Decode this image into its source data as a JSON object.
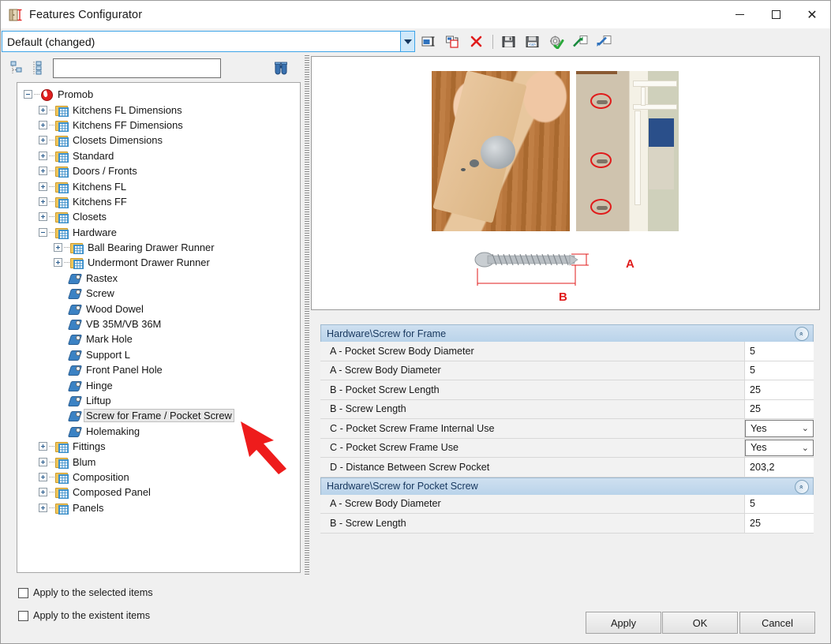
{
  "window": {
    "title": "Features Configurator",
    "icon": "cabinet-dimension-icon",
    "controls": {
      "minimize": "–",
      "maximize": "□",
      "close": "✕"
    }
  },
  "profile_combo": {
    "value": "Default (changed)",
    "arrow": "chevron-down-icon"
  },
  "toolbar": {
    "buttons": [
      {
        "name": "rename-configuration",
        "icon": "rename-icon"
      },
      {
        "name": "copy-configuration",
        "icon": "copy-icon"
      },
      {
        "name": "delete-configuration",
        "icon": "delete-x-icon"
      },
      {
        "name": "save-configuration",
        "icon": "floppy-save-icon"
      },
      {
        "name": "save-as-xml",
        "icon": "save-xml-icon"
      },
      {
        "name": "apply-settings",
        "icon": "gear-check-icon"
      },
      {
        "name": "export-configuration",
        "icon": "green-arrow-export-icon"
      },
      {
        "name": "import-configuration",
        "icon": "blue-arrow-import-icon"
      }
    ]
  },
  "tree_toolbar": {
    "collapse_all_icon": "collapse-tree-icon",
    "expand_all_icon": "expand-tree-icon",
    "search_value": "",
    "search_placeholder": "",
    "find_icon": "binoculars-icon"
  },
  "tree": {
    "root": "Promob",
    "items": [
      {
        "label": "Promob",
        "depth": 0,
        "state": "expanded",
        "icon": "promob-root-icon",
        "selected": false
      },
      {
        "label": "Kitchens FL Dimensions",
        "depth": 1,
        "state": "collapsed",
        "icon": "folder-icon",
        "selected": false
      },
      {
        "label": "Kitchens FF Dimensions",
        "depth": 1,
        "state": "collapsed",
        "icon": "folder-icon",
        "selected": false
      },
      {
        "label": "Closets Dimensions",
        "depth": 1,
        "state": "collapsed",
        "icon": "folder-icon",
        "selected": false
      },
      {
        "label": "Standard",
        "depth": 1,
        "state": "collapsed",
        "icon": "folder-icon",
        "selected": false
      },
      {
        "label": "Doors / Fronts",
        "depth": 1,
        "state": "collapsed",
        "icon": "folder-icon",
        "selected": false
      },
      {
        "label": "Kitchens FL",
        "depth": 1,
        "state": "collapsed",
        "icon": "folder-icon",
        "selected": false
      },
      {
        "label": "Kitchens FF",
        "depth": 1,
        "state": "collapsed",
        "icon": "folder-icon",
        "selected": false
      },
      {
        "label": "Closets",
        "depth": 1,
        "state": "collapsed",
        "icon": "folder-icon",
        "selected": false
      },
      {
        "label": "Hardware",
        "depth": 1,
        "state": "expanded",
        "icon": "folder-icon",
        "selected": false
      },
      {
        "label": "Ball Bearing Drawer Runner",
        "depth": 2,
        "state": "collapsed",
        "icon": "folder-icon",
        "selected": false
      },
      {
        "label": "Undermont Drawer Runner",
        "depth": 2,
        "state": "collapsed",
        "icon": "folder-icon",
        "selected": false
      },
      {
        "label": "Rastex",
        "depth": 2,
        "state": "leaf",
        "icon": "tag-icon",
        "selected": false
      },
      {
        "label": "Screw",
        "depth": 2,
        "state": "leaf",
        "icon": "tag-icon",
        "selected": false
      },
      {
        "label": "Wood Dowel",
        "depth": 2,
        "state": "leaf",
        "icon": "tag-icon",
        "selected": false
      },
      {
        "label": "VB 35M/VB 36M",
        "depth": 2,
        "state": "leaf",
        "icon": "tag-icon",
        "selected": false
      },
      {
        "label": "Mark Hole",
        "depth": 2,
        "state": "leaf",
        "icon": "tag-icon",
        "selected": false
      },
      {
        "label": "Support L",
        "depth": 2,
        "state": "leaf",
        "icon": "tag-icon",
        "selected": false
      },
      {
        "label": "Front Panel Hole",
        "depth": 2,
        "state": "leaf",
        "icon": "tag-icon",
        "selected": false
      },
      {
        "label": "Hinge",
        "depth": 2,
        "state": "leaf",
        "icon": "tag-icon",
        "selected": false
      },
      {
        "label": "Liftup",
        "depth": 2,
        "state": "leaf",
        "icon": "tag-icon",
        "selected": false
      },
      {
        "label": "Screw for Frame / Pocket Screw",
        "depth": 2,
        "state": "leaf",
        "icon": "tag-icon",
        "selected": true
      },
      {
        "label": "Holemaking",
        "depth": 2,
        "state": "leaf",
        "icon": "tag-icon",
        "selected": false
      },
      {
        "label": "Fittings",
        "depth": 1,
        "state": "collapsed",
        "icon": "folder-icon",
        "selected": false
      },
      {
        "label": "Blum",
        "depth": 1,
        "state": "collapsed",
        "icon": "folder-icon",
        "selected": false
      },
      {
        "label": "Composition",
        "depth": 1,
        "state": "collapsed",
        "icon": "folder-icon",
        "selected": false
      },
      {
        "label": "Composed Panel",
        "depth": 1,
        "state": "collapsed",
        "icon": "folder-icon",
        "selected": false
      },
      {
        "label": "Panels",
        "depth": 1,
        "state": "collapsed",
        "icon": "folder-icon",
        "selected": false
      }
    ]
  },
  "checkboxes": [
    {
      "label": "Apply to the selected items",
      "checked": false
    },
    {
      "label": "Apply to the existent items",
      "checked": false
    }
  ],
  "preview": {
    "description": "Pocket-hole jig photo, cabinet frame with pocket holes, and a dimensioned screw diagram",
    "dim_a": "A",
    "dim_b": "B"
  },
  "property_groups": [
    {
      "title": "Hardware\\Screw for Frame",
      "collapse_icon": "chevron-double-up-icon",
      "rows": [
        {
          "name": "A - Pocket Screw Body Diameter",
          "value": "5",
          "type": "text"
        },
        {
          "name": "A - Screw Body Diameter",
          "value": "5",
          "type": "text"
        },
        {
          "name": "B - Pocket Screw Length",
          "value": "25",
          "type": "text"
        },
        {
          "name": "B - Screw Length",
          "value": "25",
          "type": "text"
        },
        {
          "name": "C - Pocket Screw Frame Internal Use",
          "value": "Yes",
          "type": "select"
        },
        {
          "name": "C - Pocket Screw Frame Use",
          "value": "Yes",
          "type": "select"
        },
        {
          "name": "D - Distance Between Screw Pocket",
          "value": "203,2",
          "type": "text"
        }
      ]
    },
    {
      "title": "Hardware\\Screw for Pocket Screw",
      "collapse_icon": "chevron-double-up-icon",
      "rows": [
        {
          "name": "A - Screw Body Diameter",
          "value": "5",
          "type": "text"
        },
        {
          "name": "B - Screw Length",
          "value": "25",
          "type": "text"
        }
      ]
    }
  ],
  "footer_buttons": [
    {
      "name": "apply-button",
      "label": "Apply"
    },
    {
      "name": "ok-button",
      "label": "OK"
    },
    {
      "name": "cancel-button",
      "label": "Cancel"
    }
  ],
  "colors": {
    "accent_blue": "#3da4e8",
    "group_header": "#b9d3ea",
    "annotation_red": "#ee1c1c",
    "selection_gray": "#e8e8e8"
  }
}
